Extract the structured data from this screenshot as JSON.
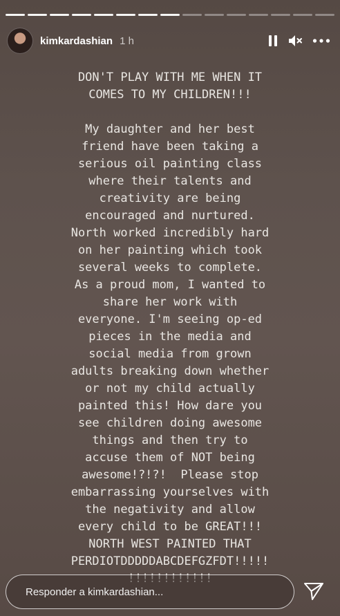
{
  "story": {
    "progress": {
      "segments_total": 15,
      "segments_done": 8
    },
    "header": {
      "username": "kimkardashian",
      "time": "1 h"
    },
    "icons": {
      "pause": "pause-icon",
      "mute": "muted-speaker-icon",
      "more": "more-options-icon",
      "send": "send-icon",
      "avatar": "profile-avatar"
    },
    "text_lines": [
      "DON'T PLAY WITH ME WHEN IT",
      "COMES TO MY CHILDREN!!!",
      "",
      "My daughter and her best",
      "friend have been taking a",
      "serious oil painting class",
      "where their talents and",
      "creativity are being",
      "encouraged and nurtured.",
      "North worked incredibly hard",
      "on her painting which took",
      "several weeks to complete.",
      "As a proud mom, I wanted to",
      "share her work with",
      "everyone. I'm seeing op-ed",
      "pieces in the media and",
      "social media from grown",
      "adults breaking down whether",
      "or not my child actually",
      "painted this! How dare you",
      "see children doing awesome",
      "things and then try to",
      "accuse them of NOT being",
      "awesome!?!?!  Please stop",
      "embarrassing yourselves with",
      "the negativity and allow",
      "every child to be GREAT!!!",
      "NORTH WEST PAINTED THAT",
      "PERDIOTDDDDDABCDEFGZFDT!!!!!",
      "!!!!!!!!!!!!"
    ],
    "reply": {
      "placeholder": "Responder a kimkardashian..."
    },
    "colors": {
      "background": "#5e524d",
      "text": "#e9e6e2"
    }
  }
}
